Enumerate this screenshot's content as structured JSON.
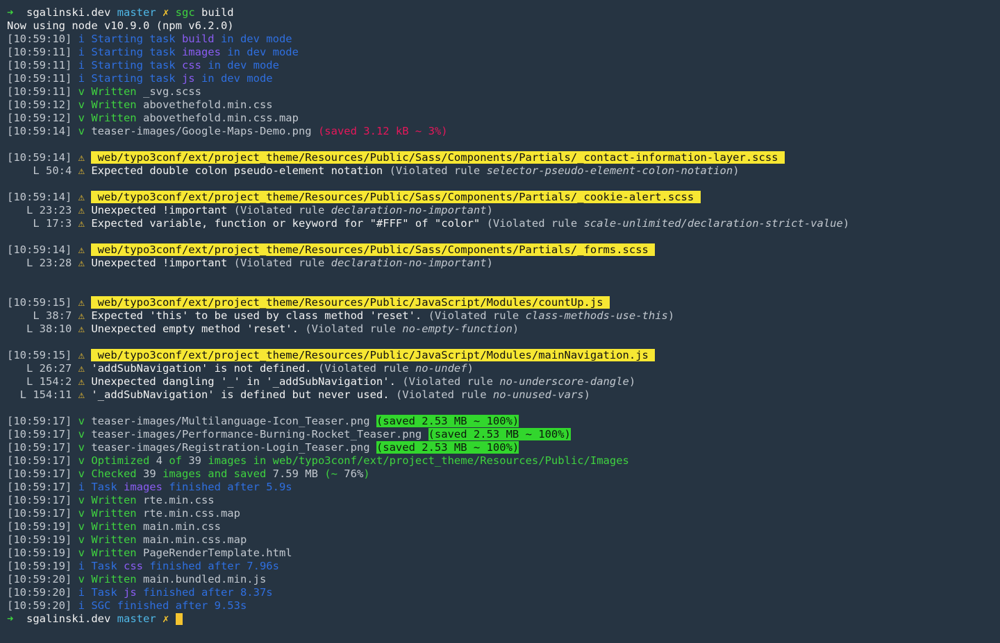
{
  "terminal": {
    "lines": [
      {
        "kind": "prompt",
        "segments": [
          {
            "t": "➜  ",
            "c": "gr"
          },
          {
            "t": "sgalinski.dev ",
            "c": "wh"
          },
          {
            "t": "master ",
            "c": "cy"
          },
          {
            "t": "✗ ",
            "c": "ye"
          },
          {
            "t": "sgc ",
            "c": "gr"
          },
          {
            "t": "build",
            "c": "wh"
          }
        ]
      },
      {
        "kind": "output",
        "segments": [
          {
            "t": "Now using node v10.9.0 (npm v6.2.0)",
            "c": "wh"
          }
        ]
      },
      {
        "kind": "log",
        "segments": [
          {
            "t": "[10:59:10] ",
            "c": "ts"
          },
          {
            "t": "i Starting task ",
            "c": "bl"
          },
          {
            "t": "build",
            "c": "pu"
          },
          {
            "t": " in dev mode",
            "c": "bl"
          }
        ]
      },
      {
        "kind": "log",
        "segments": [
          {
            "t": "[10:59:11] ",
            "c": "ts"
          },
          {
            "t": "i Starting task ",
            "c": "bl"
          },
          {
            "t": "images",
            "c": "pu"
          },
          {
            "t": " in dev mode",
            "c": "bl"
          }
        ]
      },
      {
        "kind": "log",
        "segments": [
          {
            "t": "[10:59:11] ",
            "c": "ts"
          },
          {
            "t": "i Starting task ",
            "c": "bl"
          },
          {
            "t": "css",
            "c": "pu"
          },
          {
            "t": " in dev mode",
            "c": "bl"
          }
        ]
      },
      {
        "kind": "log",
        "segments": [
          {
            "t": "[10:59:11] ",
            "c": "ts"
          },
          {
            "t": "i Starting task ",
            "c": "bl"
          },
          {
            "t": "js",
            "c": "pu"
          },
          {
            "t": " in dev mode",
            "c": "bl"
          }
        ]
      },
      {
        "kind": "log",
        "segments": [
          {
            "t": "[10:59:11] ",
            "c": "ts"
          },
          {
            "t": "v Written ",
            "c": "gr"
          },
          {
            "t": "_svg.scss",
            "c": "dim"
          }
        ]
      },
      {
        "kind": "log",
        "segments": [
          {
            "t": "[10:59:12] ",
            "c": "ts"
          },
          {
            "t": "v Written ",
            "c": "gr"
          },
          {
            "t": "abovethefold.min.css",
            "c": "dim"
          }
        ]
      },
      {
        "kind": "log",
        "segments": [
          {
            "t": "[10:59:12] ",
            "c": "ts"
          },
          {
            "t": "v Written ",
            "c": "gr"
          },
          {
            "t": "abovethefold.min.css.map",
            "c": "dim"
          }
        ]
      },
      {
        "kind": "log",
        "segments": [
          {
            "t": "[10:59:14] ",
            "c": "ts"
          },
          {
            "t": "v ",
            "c": "gr"
          },
          {
            "t": "teaser-images/Google-Maps-Demo.png ",
            "c": "dim"
          },
          {
            "t": "(saved 3.12 kB ~ 3%)",
            "c": "rd"
          }
        ]
      },
      {
        "kind": "blank",
        "segments": []
      },
      {
        "kind": "file",
        "segments": [
          {
            "t": "[10:59:14] ",
            "c": "ts"
          },
          {
            "t": "⚠ ",
            "c": "ye"
          },
          {
            "t": " web/typo3conf/ext/project_theme/Resources/Public/Sass/Components/Partials/_contact-information-layer.scss ",
            "c": "hl"
          }
        ]
      },
      {
        "kind": "issue",
        "segments": [
          {
            "t": "    L 50:4 ",
            "c": "ts"
          },
          {
            "t": "⚠ ",
            "c": "ye"
          },
          {
            "t": "Expected double colon pseudo-element notation ",
            "c": "wh"
          },
          {
            "t": "(Violated rule ",
            "c": "rule"
          },
          {
            "t": "selector-pseudo-element-colon-notation",
            "c": "it"
          },
          {
            "t": ")",
            "c": "rule"
          }
        ]
      },
      {
        "kind": "blank",
        "segments": []
      },
      {
        "kind": "file",
        "segments": [
          {
            "t": "[10:59:14] ",
            "c": "ts"
          },
          {
            "t": "⚠ ",
            "c": "ye"
          },
          {
            "t": " web/typo3conf/ext/project_theme/Resources/Public/Sass/Components/Partials/_cookie-alert.scss ",
            "c": "hl"
          }
        ]
      },
      {
        "kind": "issue",
        "segments": [
          {
            "t": "   L 23:23 ",
            "c": "ts"
          },
          {
            "t": "⚠ ",
            "c": "ye"
          },
          {
            "t": "Unexpected !important ",
            "c": "wh"
          },
          {
            "t": "(Violated rule ",
            "c": "rule"
          },
          {
            "t": "declaration-no-important",
            "c": "it"
          },
          {
            "t": ")",
            "c": "rule"
          }
        ]
      },
      {
        "kind": "issue",
        "segments": [
          {
            "t": "    L 17:3 ",
            "c": "ts"
          },
          {
            "t": "⚠ ",
            "c": "ye"
          },
          {
            "t": "Expected variable, function or keyword for \"#FFF\" of \"color\" ",
            "c": "wh"
          },
          {
            "t": "(Violated rule ",
            "c": "rule"
          },
          {
            "t": "scale-unlimited/declaration-strict-value",
            "c": "it"
          },
          {
            "t": ")",
            "c": "rule"
          }
        ]
      },
      {
        "kind": "blank",
        "segments": []
      },
      {
        "kind": "file",
        "segments": [
          {
            "t": "[10:59:14] ",
            "c": "ts"
          },
          {
            "t": "⚠ ",
            "c": "ye"
          },
          {
            "t": " web/typo3conf/ext/project_theme/Resources/Public/Sass/Components/Partials/_forms.scss ",
            "c": "hl"
          }
        ]
      },
      {
        "kind": "issue",
        "segments": [
          {
            "t": "   L 23:28 ",
            "c": "ts"
          },
          {
            "t": "⚠ ",
            "c": "ye"
          },
          {
            "t": "Unexpected !important ",
            "c": "wh"
          },
          {
            "t": "(Violated rule ",
            "c": "rule"
          },
          {
            "t": "declaration-no-important",
            "c": "it"
          },
          {
            "t": ")",
            "c": "rule"
          }
        ]
      },
      {
        "kind": "blank",
        "segments": []
      },
      {
        "kind": "blank",
        "segments": []
      },
      {
        "kind": "file",
        "segments": [
          {
            "t": "[10:59:15] ",
            "c": "ts"
          },
          {
            "t": "⚠ ",
            "c": "ye"
          },
          {
            "t": " web/typo3conf/ext/project_theme/Resources/Public/JavaScript/Modules/countUp.js ",
            "c": "hl"
          }
        ]
      },
      {
        "kind": "issue",
        "segments": [
          {
            "t": "    L 38:7 ",
            "c": "ts"
          },
          {
            "t": "⚠ ",
            "c": "ye"
          },
          {
            "t": "Expected 'this' to be used by class method 'reset'. ",
            "c": "wh"
          },
          {
            "t": "(Violated rule ",
            "c": "rule"
          },
          {
            "t": "class-methods-use-this",
            "c": "it"
          },
          {
            "t": ")",
            "c": "rule"
          }
        ]
      },
      {
        "kind": "issue",
        "segments": [
          {
            "t": "   L 38:10 ",
            "c": "ts"
          },
          {
            "t": "⚠ ",
            "c": "ye"
          },
          {
            "t": "Unexpected empty method 'reset'. ",
            "c": "wh"
          },
          {
            "t": "(Violated rule ",
            "c": "rule"
          },
          {
            "t": "no-empty-function",
            "c": "it"
          },
          {
            "t": ")",
            "c": "rule"
          }
        ]
      },
      {
        "kind": "blank",
        "segments": []
      },
      {
        "kind": "file",
        "segments": [
          {
            "t": "[10:59:15] ",
            "c": "ts"
          },
          {
            "t": "⚠ ",
            "c": "ye"
          },
          {
            "t": " web/typo3conf/ext/project_theme/Resources/Public/JavaScript/Modules/mainNavigation.js ",
            "c": "hl"
          }
        ]
      },
      {
        "kind": "issue",
        "segments": [
          {
            "t": "   L 26:27 ",
            "c": "ts"
          },
          {
            "t": "⚠ ",
            "c": "ye"
          },
          {
            "t": "'addSubNavigation' is not defined. ",
            "c": "wh"
          },
          {
            "t": "(Violated rule ",
            "c": "rule"
          },
          {
            "t": "no-undef",
            "c": "it"
          },
          {
            "t": ")",
            "c": "rule"
          }
        ]
      },
      {
        "kind": "issue",
        "segments": [
          {
            "t": "   L 154:2 ",
            "c": "ts"
          },
          {
            "t": "⚠ ",
            "c": "ye"
          },
          {
            "t": "Unexpected dangling '_' in '_addSubNavigation'. ",
            "c": "wh"
          },
          {
            "t": "(Violated rule ",
            "c": "rule"
          },
          {
            "t": "no-underscore-dangle",
            "c": "it"
          },
          {
            "t": ")",
            "c": "rule"
          }
        ]
      },
      {
        "kind": "issue",
        "segments": [
          {
            "t": "  L 154:11 ",
            "c": "ts"
          },
          {
            "t": "⚠ ",
            "c": "ye"
          },
          {
            "t": "'_addSubNavigation' is defined but never used. ",
            "c": "wh"
          },
          {
            "t": "(Violated rule ",
            "c": "rule"
          },
          {
            "t": "no-unused-vars",
            "c": "it"
          },
          {
            "t": ")",
            "c": "rule"
          }
        ]
      },
      {
        "kind": "blank",
        "segments": []
      },
      {
        "kind": "log",
        "segments": [
          {
            "t": "[10:59:17] ",
            "c": "ts"
          },
          {
            "t": "v ",
            "c": "gr"
          },
          {
            "t": "teaser-images/Multilanguage-Icon_Teaser.png ",
            "c": "dim"
          },
          {
            "t": "(saved 2.53 MB ~ 100%)",
            "c": "gbg"
          }
        ]
      },
      {
        "kind": "log",
        "segments": [
          {
            "t": "[10:59:17] ",
            "c": "ts"
          },
          {
            "t": "v ",
            "c": "gr"
          },
          {
            "t": "teaser-images/Performance-Burning-Rocket_Teaser.png ",
            "c": "dim"
          },
          {
            "t": "(saved 2.53 MB ~ 100%)",
            "c": "gbg"
          }
        ]
      },
      {
        "kind": "log",
        "segments": [
          {
            "t": "[10:59:17] ",
            "c": "ts"
          },
          {
            "t": "v ",
            "c": "gr"
          },
          {
            "t": "teaser-images/Registration-Login_Teaser.png ",
            "c": "dim"
          },
          {
            "t": "(saved 2.53 MB ~ 100%)",
            "c": "gbg"
          }
        ]
      },
      {
        "kind": "log",
        "segments": [
          {
            "t": "[10:59:17] ",
            "c": "ts"
          },
          {
            "t": "v Optimized ",
            "c": "gr"
          },
          {
            "t": "4",
            "c": "dim"
          },
          {
            "t": " of ",
            "c": "gr"
          },
          {
            "t": "39",
            "c": "dim"
          },
          {
            "t": " images in web/typo3conf/ext/project_theme/Resources/Public/Images",
            "c": "gr"
          }
        ]
      },
      {
        "kind": "log",
        "segments": [
          {
            "t": "[10:59:17] ",
            "c": "ts"
          },
          {
            "t": "v Checked ",
            "c": "gr"
          },
          {
            "t": "39",
            "c": "dim"
          },
          {
            "t": " images and saved ",
            "c": "gr"
          },
          {
            "t": "7.59 MB",
            "c": "dim"
          },
          {
            "t": " (~ ",
            "c": "gr"
          },
          {
            "t": "76%",
            "c": "dim"
          },
          {
            "t": ")",
            "c": "gr"
          }
        ]
      },
      {
        "kind": "log",
        "segments": [
          {
            "t": "[10:59:17] ",
            "c": "ts"
          },
          {
            "t": "i Task ",
            "c": "bl"
          },
          {
            "t": "images",
            "c": "pu"
          },
          {
            "t": " finished after 5.9s",
            "c": "bl"
          }
        ]
      },
      {
        "kind": "log",
        "segments": [
          {
            "t": "[10:59:17] ",
            "c": "ts"
          },
          {
            "t": "v Written ",
            "c": "gr"
          },
          {
            "t": "rte.min.css",
            "c": "dim"
          }
        ]
      },
      {
        "kind": "log",
        "segments": [
          {
            "t": "[10:59:17] ",
            "c": "ts"
          },
          {
            "t": "v Written ",
            "c": "gr"
          },
          {
            "t": "rte.min.css.map",
            "c": "dim"
          }
        ]
      },
      {
        "kind": "log",
        "segments": [
          {
            "t": "[10:59:19] ",
            "c": "ts"
          },
          {
            "t": "v Written ",
            "c": "gr"
          },
          {
            "t": "main.min.css",
            "c": "dim"
          }
        ]
      },
      {
        "kind": "log",
        "segments": [
          {
            "t": "[10:59:19] ",
            "c": "ts"
          },
          {
            "t": "v Written ",
            "c": "gr"
          },
          {
            "t": "main.min.css.map",
            "c": "dim"
          }
        ]
      },
      {
        "kind": "log",
        "segments": [
          {
            "t": "[10:59:19] ",
            "c": "ts"
          },
          {
            "t": "v Written ",
            "c": "gr"
          },
          {
            "t": "PageRenderTemplate.html",
            "c": "dim"
          }
        ]
      },
      {
        "kind": "log",
        "segments": [
          {
            "t": "[10:59:19] ",
            "c": "ts"
          },
          {
            "t": "i Task ",
            "c": "bl"
          },
          {
            "t": "css",
            "c": "pu"
          },
          {
            "t": " finished after 7.96s",
            "c": "bl"
          }
        ]
      },
      {
        "kind": "log",
        "segments": [
          {
            "t": "[10:59:20] ",
            "c": "ts"
          },
          {
            "t": "v Written ",
            "c": "gr"
          },
          {
            "t": "main.bundled.min.js",
            "c": "dim"
          }
        ]
      },
      {
        "kind": "log",
        "segments": [
          {
            "t": "[10:59:20] ",
            "c": "ts"
          },
          {
            "t": "i Task ",
            "c": "bl"
          },
          {
            "t": "js",
            "c": "pu"
          },
          {
            "t": " finished after 8.37s",
            "c": "bl"
          }
        ]
      },
      {
        "kind": "log",
        "segments": [
          {
            "t": "[10:59:20] ",
            "c": "ts"
          },
          {
            "t": "i SGC finished after 9.53s",
            "c": "bl"
          }
        ]
      },
      {
        "kind": "prompt",
        "cursor": true,
        "segments": [
          {
            "t": "➜  ",
            "c": "gr"
          },
          {
            "t": "sgalinski.dev ",
            "c": "wh"
          },
          {
            "t": "master ",
            "c": "cy"
          },
          {
            "t": "✗ ",
            "c": "ye"
          }
        ]
      }
    ]
  },
  "colors": {
    "background": "#263442",
    "timestamp": "#c2c8cf",
    "success": "#3fd23f",
    "info": "#2f6fe0",
    "task_name": "#8a5cf2",
    "branch": "#4fb7e6",
    "warning": "#f4c430",
    "error": "#e5175a",
    "file_highlight_bg": "#f7e733",
    "saved_highlight_bg": "#32d62d"
  },
  "icons": {
    "prompt": "arrow-right-icon",
    "dirty": "x-mark-icon",
    "warning": "warning-icon",
    "success": "check-icon",
    "info": "info-icon",
    "cursor": "block-cursor"
  }
}
